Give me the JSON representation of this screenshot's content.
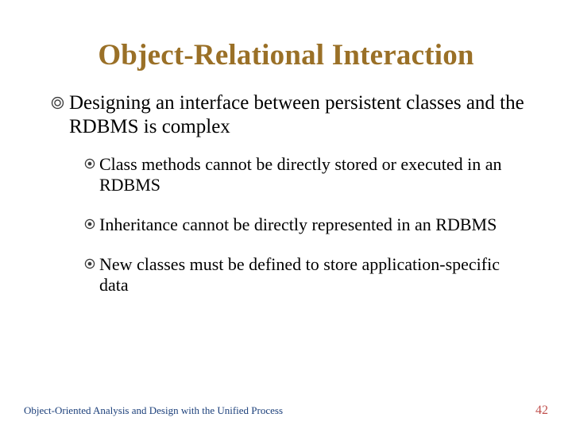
{
  "title": "Object-Relational Interaction",
  "main_bullet": "Designing an interface between persistent classes and the RDBMS is complex",
  "sub_bullets": [
    "Class methods cannot be directly stored or executed in an RDBMS",
    "Inheritance cannot be directly represented in an RDBMS",
    "New classes must be defined to store application-specific data"
  ],
  "footer_left": "Object-Oriented Analysis and Design with the Unified Process",
  "footer_right": "42"
}
